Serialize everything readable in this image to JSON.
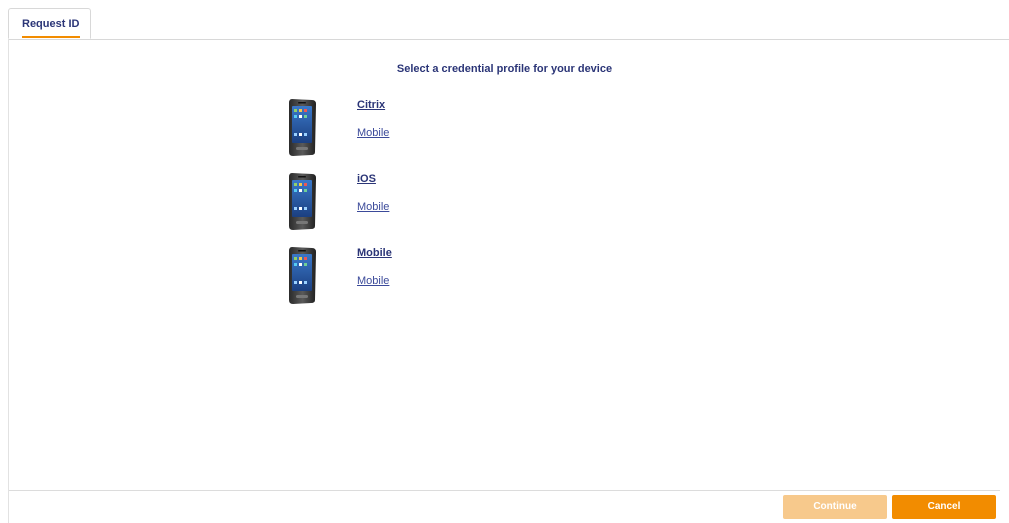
{
  "tabs": [
    {
      "label": "Request ID",
      "active": true
    }
  ],
  "main": {
    "heading": "Select a credential profile for your device",
    "profiles": [
      {
        "name": "Citrix",
        "type": "Mobile",
        "icon": "mobile-phone-icon"
      },
      {
        "name": "iOS",
        "type": "Mobile",
        "icon": "mobile-phone-icon"
      },
      {
        "name": "Mobile",
        "type": "Mobile",
        "icon": "mobile-phone-icon"
      }
    ]
  },
  "footer": {
    "continue_label": "Continue",
    "continue_enabled": false,
    "cancel_label": "Cancel"
  },
  "colors": {
    "accent": "#f28c00",
    "accent_disabled": "#f7c98c",
    "text_primary": "#2b3577",
    "link": "#3b4a9a"
  }
}
